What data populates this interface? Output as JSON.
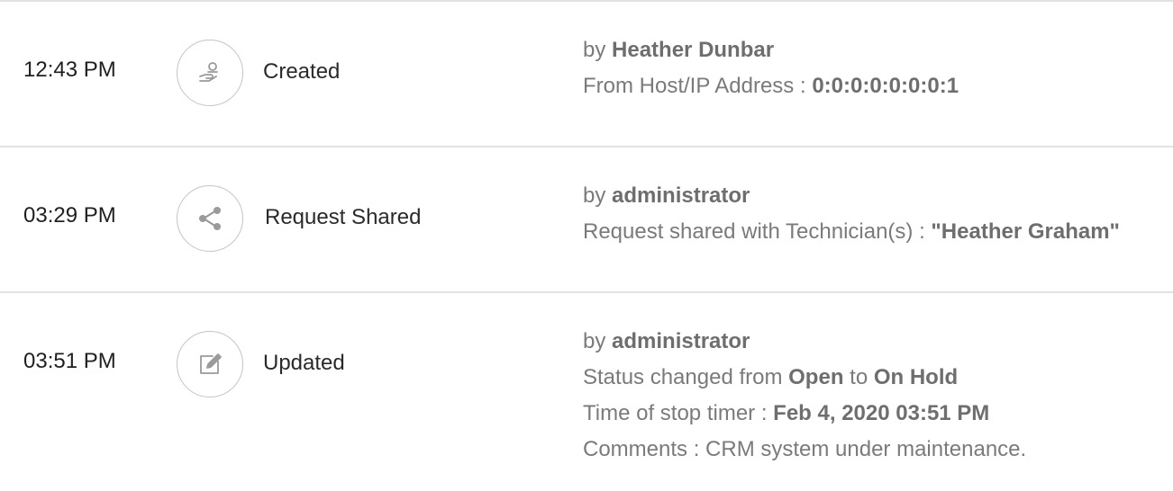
{
  "colors": {
    "divider": "#e2e2e2",
    "icon_stroke": "#9a9a9a",
    "detail_text": "#7a7a7a",
    "time_text": "#1f1f1f"
  },
  "entries": [
    {
      "time": "12:43 PM",
      "icon": "hand-user-icon",
      "action": "Created",
      "by_prefix": "by",
      "by": "Heather Dunbar",
      "lines": [
        {
          "label": "From Host/IP Address :",
          "value": "0:0:0:0:0:0:0:1"
        }
      ]
    },
    {
      "time": "03:29 PM",
      "icon": "share-icon",
      "action": "Request Shared",
      "by_prefix": "by",
      "by": "administrator",
      "lines": [
        {
          "label": "Request shared with Technician(s) :",
          "value": "\"Heather Graham\""
        }
      ]
    },
    {
      "time": "03:51 PM",
      "icon": "edit-icon",
      "action": "Updated",
      "by_prefix": "by",
      "by": "administrator",
      "status": {
        "prefix": "Status changed from",
        "from": "Open",
        "mid": "to",
        "to": "On Hold"
      },
      "lines": [
        {
          "label": "Time of stop timer :",
          "value": "Feb 4, 2020 03:51 PM"
        },
        {
          "label": "Comments : CRM system under maintenance.",
          "value": ""
        }
      ]
    }
  ]
}
